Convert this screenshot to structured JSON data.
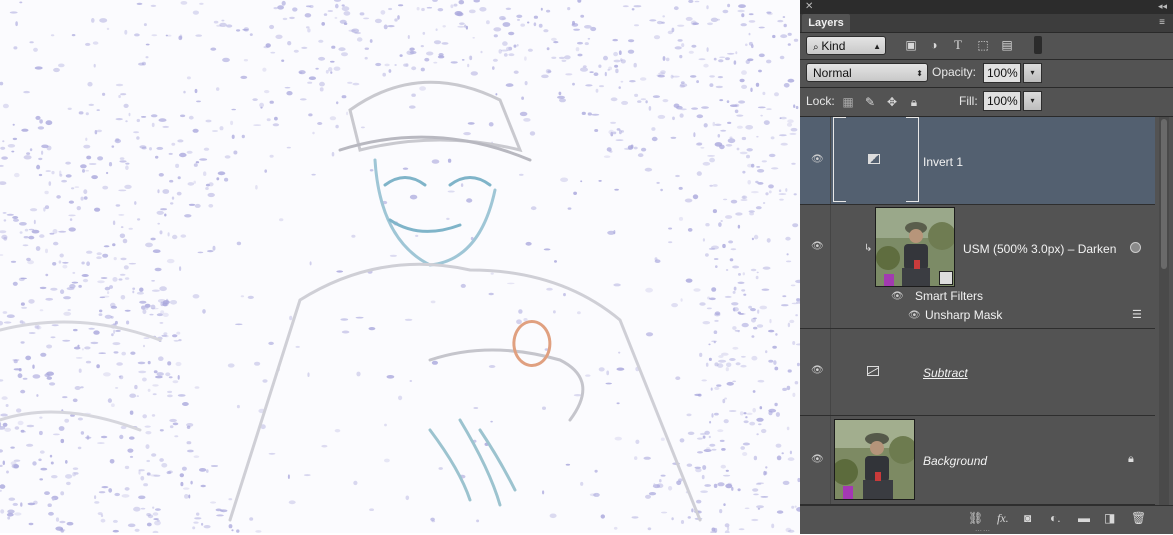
{
  "panel": {
    "tab_label": "Layers",
    "filter": {
      "label": "Kind"
    },
    "filter_icons": [
      "image-filter-icon",
      "adjustment-filter-icon",
      "type-filter-icon",
      "shape-filter-icon",
      "smart-object-filter-icon",
      "filter-toggle-icon"
    ],
    "blend_mode": "Normal",
    "opacity_label": "Opacity:",
    "opacity_value": "100%",
    "lock_label": "Lock:",
    "lock_icons": [
      "lock-transparent-icon",
      "lock-image-icon",
      "lock-position-icon",
      "lock-all-icon"
    ],
    "fill_label": "Fill:",
    "fill_value": "100%"
  },
  "layers": [
    {
      "name": "Invert 1",
      "type": "adjustment",
      "selected": true
    },
    {
      "name": "USM (500%  3.0px) – Darken",
      "type": "smart-object",
      "filters_label": "Smart Filters",
      "filter_name": "Unsharp Mask"
    },
    {
      "name": "Subtract",
      "type": "adjustment"
    },
    {
      "name": "Background",
      "type": "image",
      "locked": true
    }
  ],
  "footer_icons": [
    "link-layers-icon",
    "fx-icon",
    "add-mask-icon",
    "new-adjustment-icon",
    "new-group-icon",
    "new-layer-icon",
    "trash-icon"
  ],
  "colors": {
    "panel_bg": "#535353",
    "selected_layer": "#536070",
    "canvas_speckle": "#a9a7dc"
  }
}
